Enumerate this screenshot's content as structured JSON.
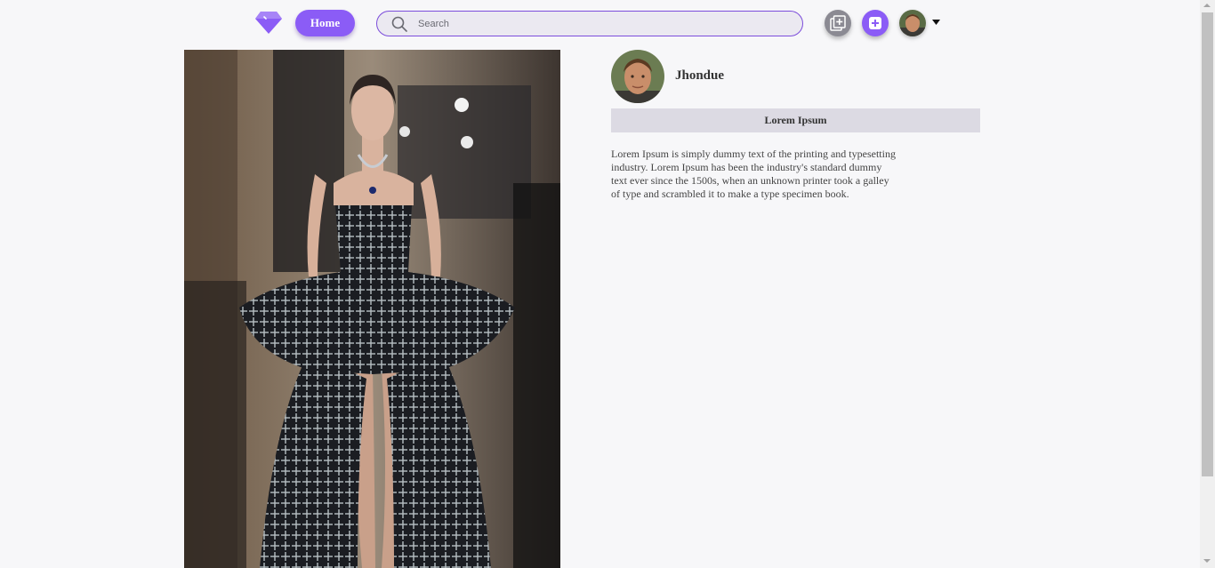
{
  "nav": {
    "logo_icon": "diamond-icon",
    "home_label": "Home",
    "search_placeholder": "Search",
    "search_icon": "search-icon",
    "gallery_button_icon": "gallery-add-icon",
    "add_button_icon": "plus-square-icon",
    "avatar_icon": "user-avatar",
    "menu_caret_icon": "caret-down-icon"
  },
  "post": {
    "image_alt": "fashion-model-photo",
    "author": "Jhondue",
    "title": "Lorem Ipsum",
    "description": "Lorem Ipsum is simply dummy text of the printing and typesetting industry. Lorem Ipsum has been the industry's standard dummy text ever since the 1500s, when an unknown printer took a galley of type and scrambled it to make a type specimen book."
  },
  "colors": {
    "accent": "#8b5cf6",
    "background": "#f7f7f9",
    "title_bar": "#dcdae3"
  }
}
